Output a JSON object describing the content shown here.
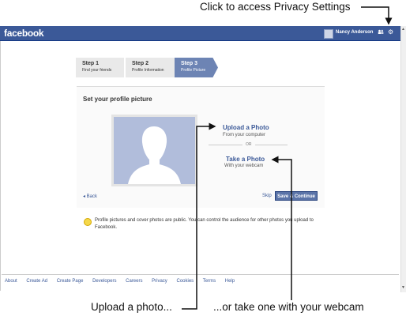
{
  "annotations": {
    "privacy": "Click to access Privacy Settings",
    "upload": "Upload a photo...",
    "webcam": "...or take one with your webcam"
  },
  "browser": {
    "logo": "facebook",
    "username": "Nancy Anderson",
    "friends_icon": "friends-icon",
    "gear_icon": "gear-icon",
    "scroll_up": "▲",
    "scroll_down": "▼"
  },
  "steps": [
    {
      "title": "Step 1",
      "subtitle": "Find your friends"
    },
    {
      "title": "Step 2",
      "subtitle": "Profile Information"
    },
    {
      "title": "Step 3",
      "subtitle": "Profile Picture"
    }
  ],
  "panel": {
    "title": "Set your profile picture",
    "upload_title": "Upload a Photo",
    "upload_sub": "From your computer",
    "or": "OR",
    "take_title": "Take a Photo",
    "take_sub": "With your webcam",
    "back": "◂ Back",
    "skip": "Skip",
    "continue": "Save & Continue"
  },
  "notice": "Profile pictures and cover photos are public. You can control the audience for other photos you upload to Facebook.",
  "footer": [
    "About",
    "Create Ad",
    "Create Page",
    "Developers",
    "Careers",
    "Privacy",
    "Cookies",
    "Terms",
    "Help"
  ]
}
